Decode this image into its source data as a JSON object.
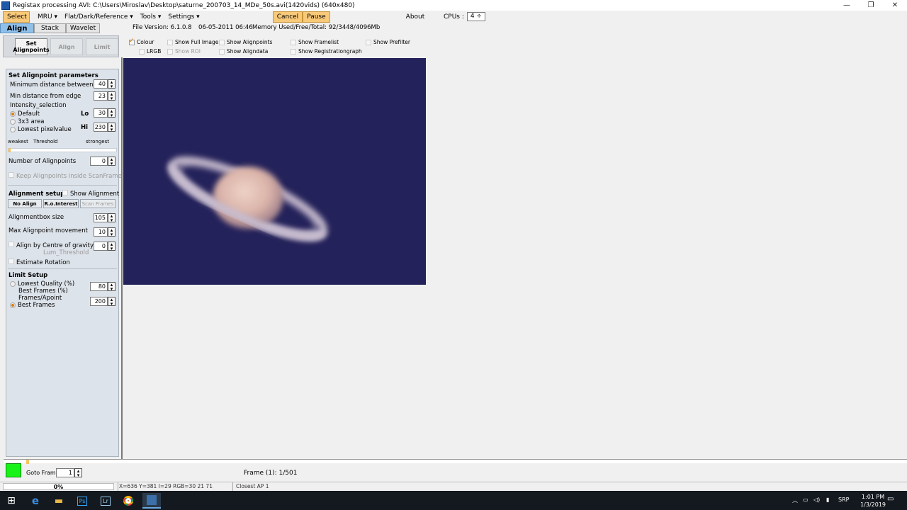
{
  "window": {
    "title": "Registax processing AVI: C:\\Users\\Miroslav\\Desktop\\saturne_200703_14_MDe_50s.avi(1420vids) (640x480)",
    "controls": [
      "—",
      "❐",
      "✕"
    ]
  },
  "menu": {
    "select": "Select",
    "mru": "MRU ▾",
    "flat": "Flat/Dark/Reference ▾",
    "tools": "Tools ▾",
    "settings": "Settings ▾",
    "cancel": "Cancel",
    "pause": "Pause",
    "about": "About",
    "cpus_label": "CPUs :",
    "cpus_value": "4 ÷"
  },
  "tabs": {
    "align": "Align",
    "stack": "Stack",
    "wavelet": "Wavelet"
  },
  "fileinfo": {
    "version": "File Version: 6.1.0.8",
    "date": "06-05-2011 06:46",
    "memory": "Memory Used/Free/Total: 92/3448/4096Mb"
  },
  "subtabs": {
    "set": "Set Alignpoints",
    "align": "Align",
    "limit": "Limit"
  },
  "options": {
    "colour": "Colour",
    "lrgb": "LRGB",
    "show_full_image": "Show Full Image",
    "show_roi": "Show ROI",
    "show_alignpoints": "Show Alignpoints",
    "show_aligndata": "Show Aligndata",
    "show_framelist": "Show Framelist",
    "show_registrationgraph": "Show Registrationgraph",
    "show_prefilter": "Show Prefilter"
  },
  "alignpoint": {
    "header": "Set Alignpoint parameters",
    "min_dist_between": "Minimum distance between",
    "min_dist_between_val": "40",
    "min_dist_edge": "Min distance from edge",
    "min_dist_edge_val": "23",
    "intensity": "Intensity_selection",
    "default": "Default",
    "area3x3": "3x3 area",
    "lowest": "Lowest pixelvalue",
    "lo": "Lo",
    "lo_val": "30",
    "hi": "Hi",
    "hi_val": "230",
    "weakest": "weakest",
    "threshold": "Threshold",
    "strongest": "strongest",
    "num_alignpoints": "Number of Alignpoints",
    "num_alignpoints_val": "0",
    "keep_inside": "Keep Alignpoints inside ScanFrame"
  },
  "alignment": {
    "header": "Alignment setup",
    "show_alignment": "Show Alignment",
    "no_align": "No Align",
    "roi": "R.o.Interest",
    "scan_frames": "Scan Frames",
    "box_size": "Alignmentbox size",
    "box_size_val": "105",
    "max_movement": "Max Alignpoint movement",
    "max_movement_val": "10",
    "centre_gravity": "Align by Centre of gravity",
    "centre_gravity_val": "0",
    "lum_threshold": "Lum_Threshold",
    "estimate_rotation": "Estimate Rotation"
  },
  "limit": {
    "header": "Limit Setup",
    "lowest_quality": "Lowest Quality (%)",
    "best_frames_pct": "Best Frames (%)",
    "val1": "80",
    "frames_apoint": "Frames/Apoint",
    "best_frames": "Best Frames",
    "val2": "200"
  },
  "bottom": {
    "goto": "Goto Frame",
    "goto_val": "1",
    "frame_label": "Frame (1): 1/501"
  },
  "status": {
    "progress": "0%",
    "coords": "X=636 Y=381 I=29 RGB=30 21 71",
    "closest": "Closest AP 1"
  },
  "taskbar": {
    "tray_lang": "SRP",
    "time": "1:01 PM",
    "date": "1/3/2019"
  }
}
